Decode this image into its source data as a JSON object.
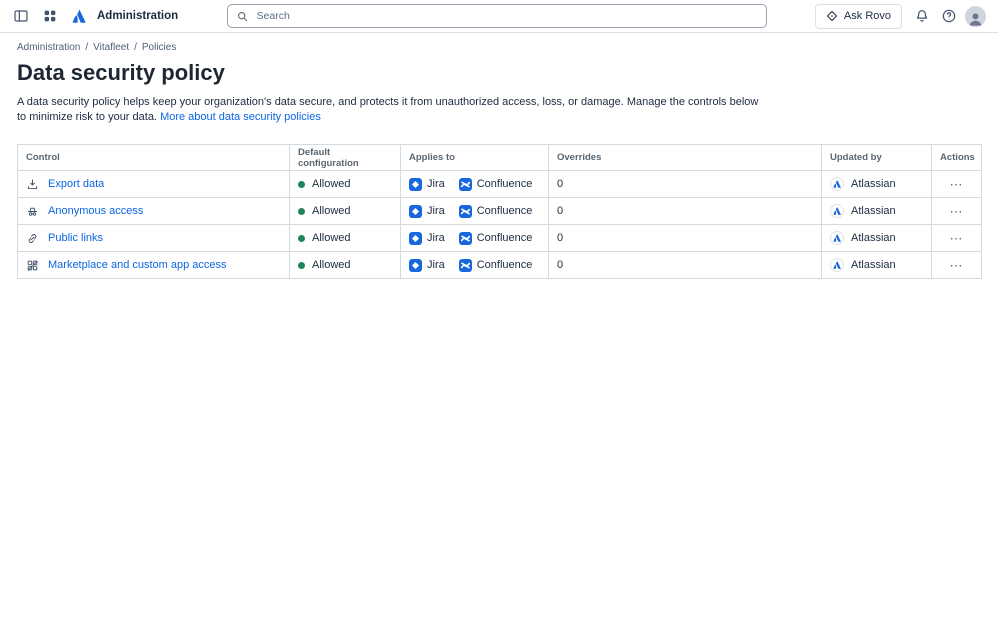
{
  "colors": {
    "brand": "#1868DB",
    "link": "#0C66E4",
    "status-green": "#1F845A",
    "text": "#1C2B41",
    "muted": "#596773",
    "border": "#D5D9E0"
  },
  "topbar": {
    "app_name": "Administration",
    "search_placeholder": "Search",
    "ask_rovo": "Ask Rovo"
  },
  "breadcrumb": {
    "separator": "/",
    "items": [
      "Administration",
      "Vitafleet",
      "Policies"
    ]
  },
  "page": {
    "title": "Data security policy",
    "description": "A data security policy helps keep your organization's data secure, and protects it from unauthorized access, loss, or damage. Manage the controls below to minimize risk to your data.",
    "learn_more": "More about data security policies"
  },
  "icons": {
    "more_actions": "⋯"
  },
  "table": {
    "headers": [
      "Control",
      "Default configuration",
      "Applies to",
      "Overrides",
      "Updated by",
      "Actions"
    ],
    "rows": [
      {
        "control": "Export data",
        "icon": "export-data-icon",
        "default_configuration": "Allowed",
        "applies_to": [
          "Jira",
          "Confluence"
        ],
        "overrides": "0",
        "updated_by": "Atlassian"
      },
      {
        "control": "Anonymous access",
        "icon": "anonymous-access-icon",
        "default_configuration": "Allowed",
        "applies_to": [
          "Jira",
          "Confluence"
        ],
        "overrides": "0",
        "updated_by": "Atlassian"
      },
      {
        "control": "Public links",
        "icon": "public-links-icon",
        "default_configuration": "Allowed",
        "applies_to": [
          "Jira",
          "Confluence"
        ],
        "overrides": "0",
        "updated_by": "Atlassian"
      },
      {
        "control": "Marketplace and custom app access",
        "icon": "marketplace-apps-icon",
        "default_configuration": "Allowed",
        "applies_to": [
          "Jira",
          "Confluence"
        ],
        "overrides": "0",
        "updated_by": "Atlassian"
      }
    ]
  }
}
